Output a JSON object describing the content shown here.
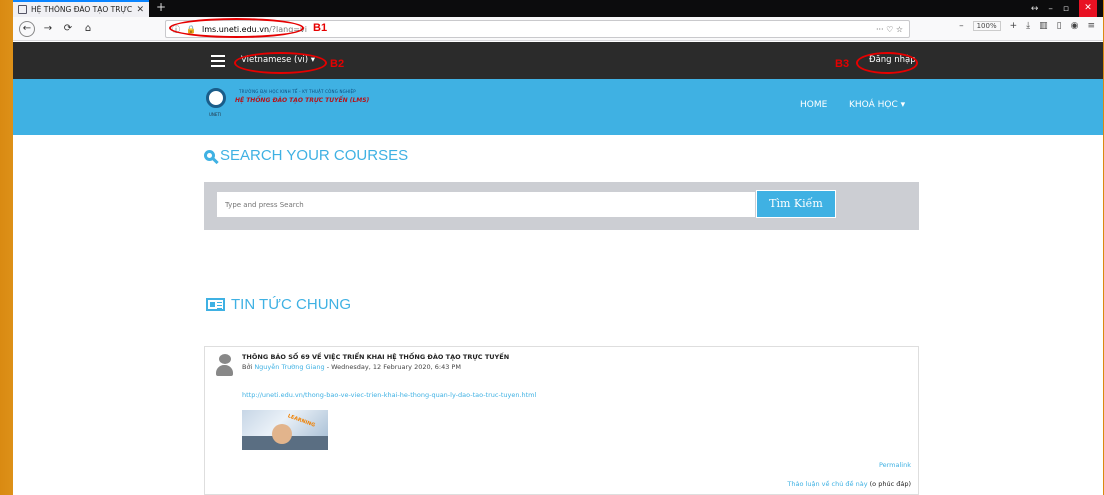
{
  "browser": {
    "tab_title": "HỆ THỐNG ĐÀO TẠO TRỰC TU",
    "tab_close": "✕",
    "new_tab": "+",
    "url_host": "lms.uneti.edu.vn",
    "url_path": "/?lang=vi",
    "url_actions": "··· ♡ ☆",
    "zoom": "100%",
    "window_controls": {
      "restore": "↔",
      "minimize": "–",
      "maximize": "▫",
      "close": "✕"
    }
  },
  "annotations": {
    "b1": "B1",
    "b2": "B2",
    "b3": "B3"
  },
  "site": {
    "language": "Vietnamese (vi) ▾",
    "login": "Đăng nhập",
    "logo_small": "TRƯỜNG ĐẠI HỌC KINH TẾ - KỸ THUẬT CÔNG NGHIỆP",
    "logo_main": "HỆ THỐNG ĐÀO TẠO TRỰC TUYẾN (LMS)",
    "logo_year": "UNETI",
    "nav": {
      "home": "HOME",
      "courses": "KHOÁ HỌC ▾"
    }
  },
  "search": {
    "title": "SEARCH YOUR COURSES",
    "placeholder": "Type and press Search",
    "button": "Tìm Kiếm"
  },
  "news": {
    "title": "TIN TỨC CHUNG",
    "post": {
      "subject": "THÔNG BÁO SỐ 69 VỀ VIỆC TRIỂN KHAI HỆ THỐNG ĐÀO TẠO TRỰC TUYẾN",
      "by": "Bởi ",
      "author": "Nguyễn Trường Giang",
      "date": " - Wednesday, 12 February 2020, 6:43 PM",
      "link": "http://uneti.edu.vn/thong-bao-ve-viec-trien-khai-he-thong-quan-ly-dao-tao-truc-tuyen.html",
      "image_label": "LEARNING",
      "permalink": "Permalink",
      "discuss": "Thảo luận về chủ đề này",
      "reply_count": " (o phúc đáp)"
    }
  }
}
